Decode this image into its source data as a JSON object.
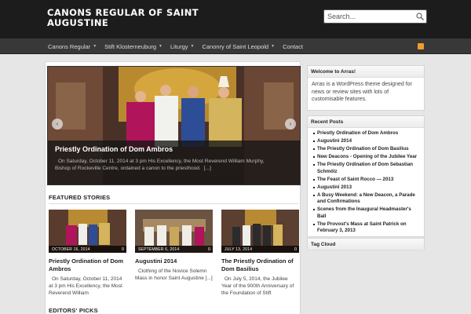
{
  "site": {
    "title": "CANONS REGULAR OF SAINT AUGUSTINE"
  },
  "search": {
    "placeholder": "Search...",
    "icon": "search-icon"
  },
  "nav": {
    "items": [
      {
        "label": "Canons Regular",
        "has_dropdown": true
      },
      {
        "label": "Stift Klosterneuburg",
        "has_dropdown": true
      },
      {
        "label": "Liturgy",
        "has_dropdown": true
      },
      {
        "label": "Canonry of Saint Leopold",
        "has_dropdown": true
      },
      {
        "label": "Contact",
        "has_dropdown": false
      }
    ],
    "rss_icon": "rss-icon"
  },
  "slider": {
    "title": "Priestly Ordination of Dom Ambros",
    "text": "On Saturday, October 11, 2014 at 3 pm His Excellency, the Most Reverend William Murphy, Bishop of Rockeville Centre, ordained a canon to the priesthood.",
    "more": "[...]",
    "prev": "‹",
    "next": "›"
  },
  "featured": {
    "heading": "FEATURED STORIES",
    "stories": [
      {
        "date": "OCTOBER 16, 2014",
        "comments": "0",
        "title": "Priestly Ordination of Dom Ambros",
        "excerpt": "On Saturday, October 11, 2014 at 3 pm His Excellency, the Most Reverend William"
      },
      {
        "date": "SEPTEMBER 6, 2014",
        "comments": "0",
        "title": "Augustini 2014",
        "excerpt": "Clothing of the Novice Solemn Mass in honor Saint Augustine [...]"
      },
      {
        "date": "JULY 13, 2014",
        "comments": "0",
        "title": "The Priestly Ordination of Dom Basilius",
        "excerpt": "On July 5, 2014, the Jubilee Year of the 900th Anniversary of the Foundation of Stift"
      }
    ]
  },
  "editors": {
    "heading": "EDITORS' PICKS"
  },
  "sidebar": {
    "welcome": {
      "title": "Welcome to Arras!",
      "text": "Arras is a WordPress theme designed for news or review sites with lots of customisable features."
    },
    "recent": {
      "title": "Recent Posts",
      "items": [
        "Priestly Ordination of Dom Ambros",
        "Augustini 2014",
        "The Priestly Ordination of Dom Basilius",
        "New Deacons - Opening of the Jubilee Year",
        "The Priestly Ordination of Dom Sebastian Schmölz",
        "The Feast of Saint Rocco — 2013",
        "Augustini 2013",
        "A Busy Weekend: a New Deacon, a Parade and Confirmations",
        "Scenes from the Inaugural Headmaster's Ball",
        "The Provost's Mass at Saint Patrick on February 3, 2013"
      ]
    },
    "tags": {
      "title": "Tag Cloud"
    }
  },
  "colors": {
    "header_bg": "#1c1c1c",
    "nav_bg": "#383838",
    "page_bg": "#e6e6e6",
    "rss": "#f39c2b"
  }
}
